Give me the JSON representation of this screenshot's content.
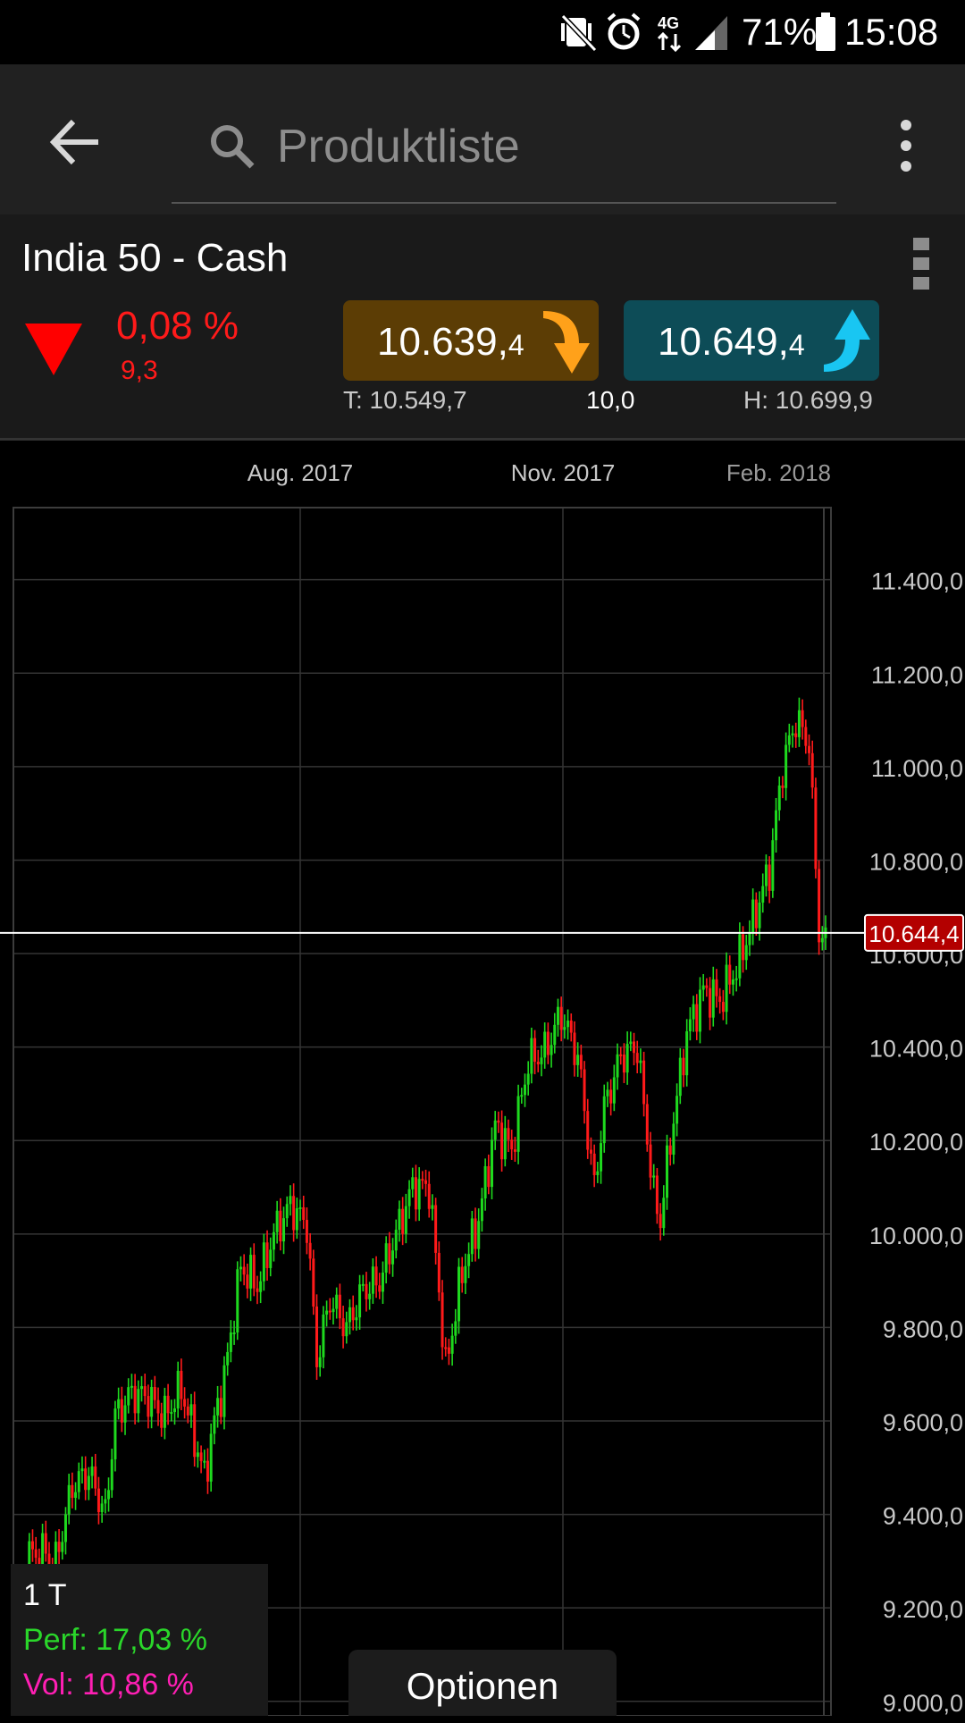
{
  "status_bar": {
    "battery_percent": "71%",
    "time": "15:08",
    "icons": [
      "mute-vibrate-icon",
      "alarm-icon",
      "4g-data-icon",
      "signal-icon",
      "battery-icon"
    ]
  },
  "app_bar": {
    "search_placeholder": "Produktliste"
  },
  "instrument": {
    "name": "India 50 - Cash",
    "change_percent": "0,08 %",
    "change_abs": "9,3",
    "sell": {
      "main": "10.639,",
      "small": "4"
    },
    "buy": {
      "main": "10.649,",
      "small": "4"
    },
    "low": "T: 10.549,7",
    "spread": "10,0",
    "high": "H: 10.699,9"
  },
  "chart_data": {
    "type": "candlestick",
    "x_tick_labels": [
      "Aug. 2017",
      "Nov. 2017",
      "Feb. 2018"
    ],
    "y_tick_labels": [
      "11.400,0",
      "11.200,0",
      "11.000,0",
      "10.800,0",
      "10.600,0",
      "10.400,0",
      "10.200,0",
      "10.000,0",
      "9.800,0",
      "9.600,0",
      "9.400,0",
      "9.200,0",
      "9.000,0"
    ],
    "ylim": [
      8990,
      11560
    ],
    "current_price": 10644.4,
    "current_price_label": "10.644,4",
    "up_color": "#1ed91e",
    "down_color": "#ff1a1a",
    "anchor_closes": [
      [
        0,
        9150
      ],
      [
        3,
        9310
      ],
      [
        8,
        9320
      ],
      [
        12,
        9300
      ],
      [
        17,
        9460
      ],
      [
        22,
        9490
      ],
      [
        27,
        9400
      ],
      [
        30,
        9610
      ],
      [
        35,
        9660
      ],
      [
        40,
        9650
      ],
      [
        45,
        9610
      ],
      [
        50,
        9670
      ],
      [
        53,
        9590
      ],
      [
        57,
        9480
      ],
      [
        60,
        9600
      ],
      [
        63,
        9690
      ],
      [
        68,
        9930
      ],
      [
        73,
        9890
      ],
      [
        78,
        10000
      ],
      [
        83,
        10060
      ],
      [
        88,
        10020
      ],
      [
        91,
        9730
      ],
      [
        95,
        9860
      ],
      [
        100,
        9800
      ],
      [
        105,
        9880
      ],
      [
        110,
        9900
      ],
      [
        115,
        10000
      ],
      [
        120,
        10100
      ],
      [
        125,
        10100
      ],
      [
        128,
        9880
      ],
      [
        130,
        9710
      ],
      [
        135,
        9920
      ],
      [
        140,
        10030
      ],
      [
        145,
        10230
      ],
      [
        150,
        10180
      ],
      [
        155,
        10370
      ],
      [
        160,
        10390
      ],
      [
        165,
        10470
      ],
      [
        170,
        10380
      ],
      [
        175,
        10100
      ],
      [
        178,
        10270
      ],
      [
        183,
        10380
      ],
      [
        188,
        10400
      ],
      [
        193,
        10080
      ],
      [
        195,
        10030
      ],
      [
        198,
        10200
      ],
      [
        203,
        10430
      ],
      [
        208,
        10520
      ],
      [
        213,
        10500
      ],
      [
        218,
        10570
      ],
      [
        223,
        10670
      ],
      [
        228,
        10780
      ],
      [
        232,
        11000
      ],
      [
        236,
        11100
      ],
      [
        240,
        11050
      ],
      [
        243,
        10650
      ],
      [
        245,
        10620
      ]
    ]
  },
  "info_box": {
    "period": "1 T",
    "perf": "Perf: 17,03 %",
    "vol": "Vol: 10,86 %"
  },
  "bottom": {
    "options_label": "Optionen"
  }
}
